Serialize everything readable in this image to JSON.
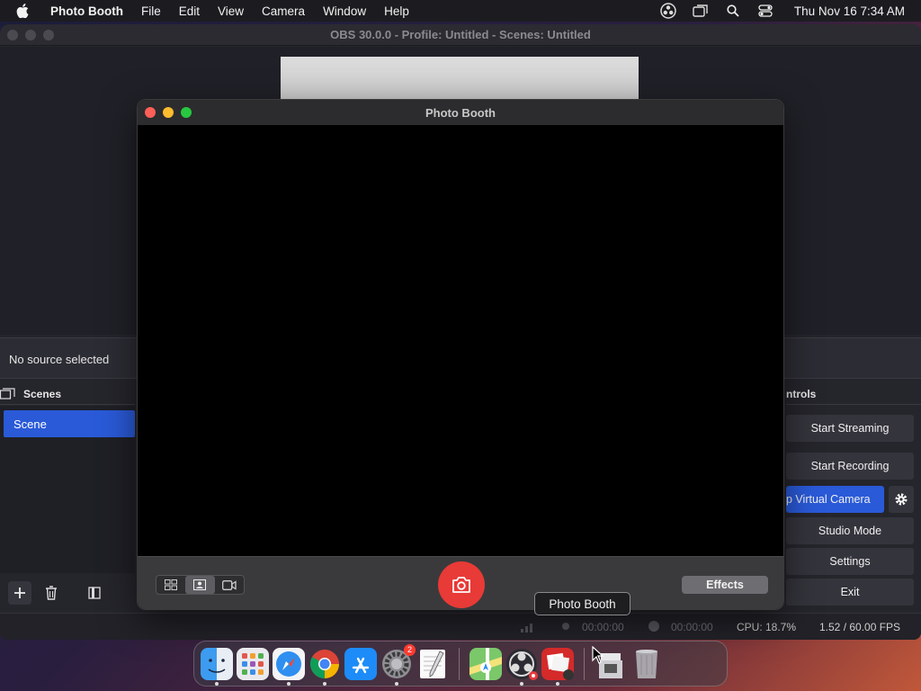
{
  "menubar": {
    "app_name": "Photo Booth",
    "items": [
      "File",
      "Edit",
      "View",
      "Camera",
      "Window",
      "Help"
    ],
    "clock": "Thu Nov 16  7:34 AM"
  },
  "obs": {
    "title": "OBS 30.0.0 - Profile: Untitled - Scenes: Untitled",
    "source_status": "No source selected",
    "scenes_header": "Scenes",
    "scene_item": "Scene",
    "controls_header": "ntrols",
    "controls": {
      "start_streaming": "Start Streaming",
      "start_recording": "Start Recording",
      "virtual_camera": "p Virtual Camera",
      "studio_mode": "Studio Mode",
      "settings": "Settings",
      "exit": "Exit"
    },
    "status": {
      "stream_time": "00:00:00",
      "rec_time": "00:00:00",
      "cpu": "CPU: 18.7%",
      "fps": "1.52 / 60.00 FPS"
    }
  },
  "photobooth": {
    "title": "Photo Booth",
    "effects_label": "Effects"
  },
  "tooltip": "Photo Booth",
  "dock": {
    "settings_badge": "2"
  }
}
